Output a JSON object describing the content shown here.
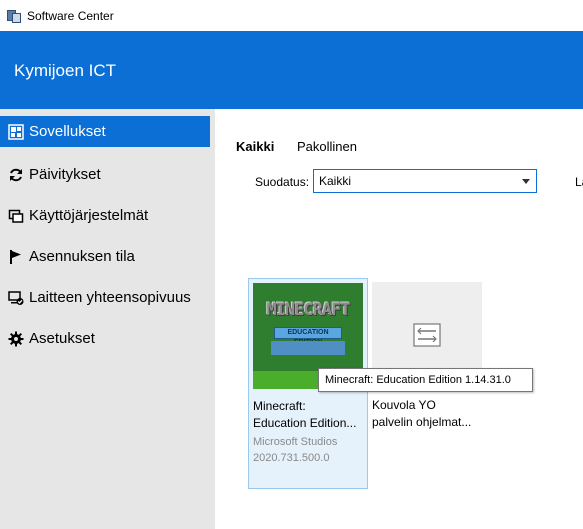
{
  "window": {
    "title": "Software Center",
    "icon": "software-center-icon"
  },
  "header": {
    "org_name": "Kymijoen ICT",
    "bg_color": "#0b6fd6"
  },
  "sidebar": {
    "items": [
      {
        "label": "Sovellukset",
        "icon": "apps-grid-icon",
        "active": true
      },
      {
        "label": "Päivitykset",
        "icon": "refresh-icon",
        "active": false
      },
      {
        "label": "Käyttöjärjestelmät",
        "icon": "windows-stack-icon",
        "active": false
      },
      {
        "label": "Asennuksen tila",
        "icon": "flag-icon",
        "active": false
      },
      {
        "label": "Laitteen yhteensopivuus",
        "icon": "device-check-icon",
        "active": false
      },
      {
        "label": "Asetukset",
        "icon": "gear-icon",
        "active": false
      }
    ]
  },
  "main": {
    "tabs": [
      {
        "label": "Kaikki",
        "selected": true
      },
      {
        "label": "Pakollinen",
        "selected": false
      }
    ],
    "filter": {
      "label": "Suodatus:",
      "value": "Kaikki"
    },
    "cut_label": "La",
    "apps": [
      {
        "name_line1": "Minecraft:",
        "name_line2": "Education Edition...",
        "publisher": "Microsoft Studios",
        "version": "2020.731.500.0",
        "logo_text": "MINECRAFT",
        "logo_subtext": "EDUCATION EDITION",
        "icon": "minecraft-logo"
      },
      {
        "name_line1": "Kouvola YO",
        "name_line2": "palvelin ohjelmat...",
        "icon": "package-icon"
      }
    ],
    "tooltip": "Minecraft: Education Edition 1.14.31.0"
  }
}
